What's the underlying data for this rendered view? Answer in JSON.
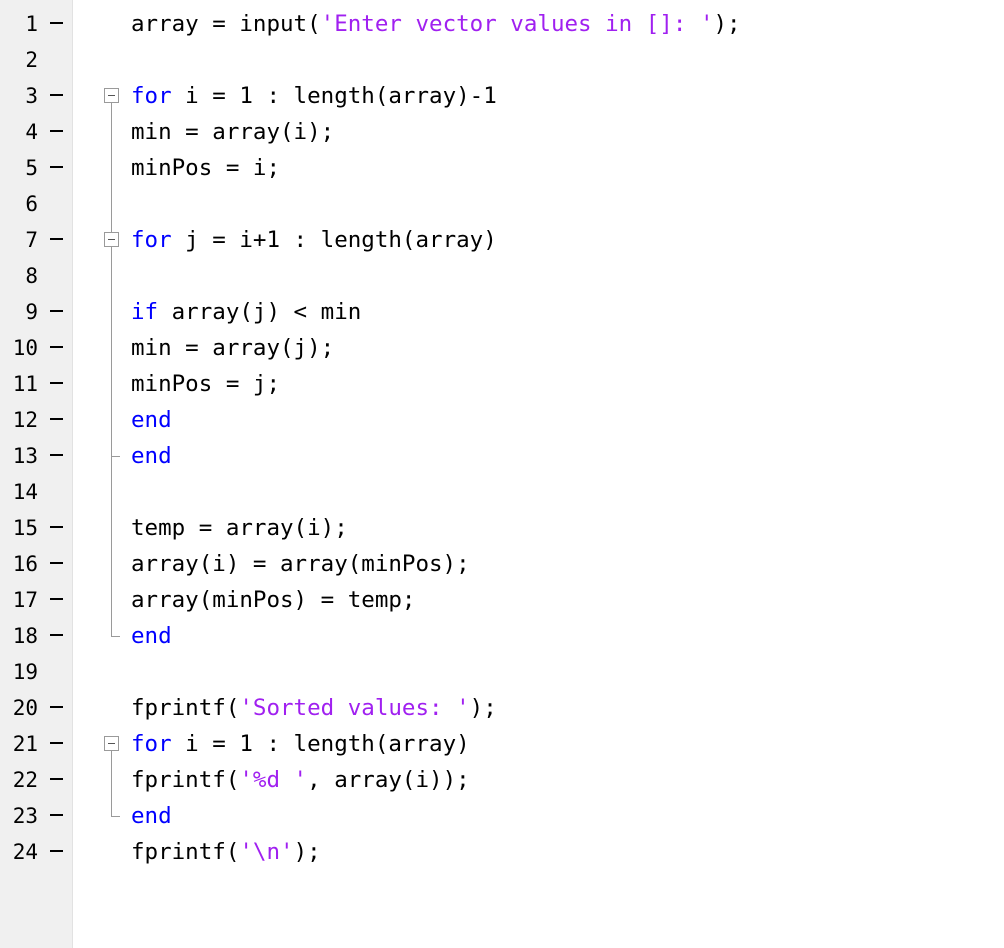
{
  "editor": {
    "lines": [
      {
        "num": "1",
        "bp": true,
        "tokens": [
          {
            "t": "array = input(",
            "c": "n"
          },
          {
            "t": "'Enter vector values in []: '",
            "c": "s"
          },
          {
            "t": ");",
            "c": "n"
          }
        ]
      },
      {
        "num": "2",
        "bp": false,
        "tokens": []
      },
      {
        "num": "3",
        "bp": true,
        "tokens": [
          {
            "t": "for",
            "c": "k"
          },
          {
            "t": " i = 1 : length(array)-1",
            "c": "n"
          }
        ]
      },
      {
        "num": "4",
        "bp": true,
        "tokens": [
          {
            "t": "min = array(i);",
            "c": "n"
          }
        ]
      },
      {
        "num": "5",
        "bp": true,
        "tokens": [
          {
            "t": "minPos = i;",
            "c": "n"
          }
        ]
      },
      {
        "num": "6",
        "bp": false,
        "tokens": []
      },
      {
        "num": "7",
        "bp": true,
        "tokens": [
          {
            "t": "for",
            "c": "k"
          },
          {
            "t": " j = i+1 : length(array)",
            "c": "n"
          }
        ]
      },
      {
        "num": "8",
        "bp": false,
        "tokens": []
      },
      {
        "num": "9",
        "bp": true,
        "tokens": [
          {
            "t": "if",
            "c": "k"
          },
          {
            "t": " array(j) < min",
            "c": "n"
          }
        ]
      },
      {
        "num": "10",
        "bp": true,
        "tokens": [
          {
            "t": "min = array(j);",
            "c": "n"
          }
        ]
      },
      {
        "num": "11",
        "bp": true,
        "tokens": [
          {
            "t": "minPos = j;",
            "c": "n"
          }
        ]
      },
      {
        "num": "12",
        "bp": true,
        "tokens": [
          {
            "t": "end",
            "c": "k"
          }
        ]
      },
      {
        "num": "13",
        "bp": true,
        "tokens": [
          {
            "t": "end",
            "c": "k"
          }
        ]
      },
      {
        "num": "14",
        "bp": false,
        "tokens": []
      },
      {
        "num": "15",
        "bp": true,
        "tokens": [
          {
            "t": "temp = array(i);",
            "c": "n"
          }
        ]
      },
      {
        "num": "16",
        "bp": true,
        "tokens": [
          {
            "t": "array(i) = array(minPos);",
            "c": "n"
          }
        ]
      },
      {
        "num": "17",
        "bp": true,
        "tokens": [
          {
            "t": "array(minPos) = temp;",
            "c": "n"
          }
        ]
      },
      {
        "num": "18",
        "bp": true,
        "tokens": [
          {
            "t": "end",
            "c": "k"
          }
        ]
      },
      {
        "num": "19",
        "bp": false,
        "tokens": []
      },
      {
        "num": "20",
        "bp": true,
        "tokens": [
          {
            "t": "fprintf(",
            "c": "n"
          },
          {
            "t": "'Sorted values: '",
            "c": "s"
          },
          {
            "t": ");",
            "c": "n"
          }
        ]
      },
      {
        "num": "21",
        "bp": true,
        "tokens": [
          {
            "t": "for",
            "c": "k"
          },
          {
            "t": " i = 1 : length(array)",
            "c": "n"
          }
        ]
      },
      {
        "num": "22",
        "bp": true,
        "tokens": [
          {
            "t": "fprintf(",
            "c": "n"
          },
          {
            "t": "'%d '",
            "c": "s"
          },
          {
            "t": ", array(i));",
            "c": "n"
          }
        ]
      },
      {
        "num": "23",
        "bp": true,
        "tokens": [
          {
            "t": "end",
            "c": "k"
          }
        ]
      },
      {
        "num": "24",
        "bp": true,
        "tokens": [
          {
            "t": "fprintf(",
            "c": "n"
          },
          {
            "t": "'\\n'",
            "c": "s"
          },
          {
            "t": ");",
            "c": "n"
          }
        ]
      }
    ],
    "folds": [
      {
        "start": 3,
        "end": 18
      },
      {
        "start": 7,
        "end": 13
      },
      {
        "start": 21,
        "end": 23
      }
    ]
  }
}
